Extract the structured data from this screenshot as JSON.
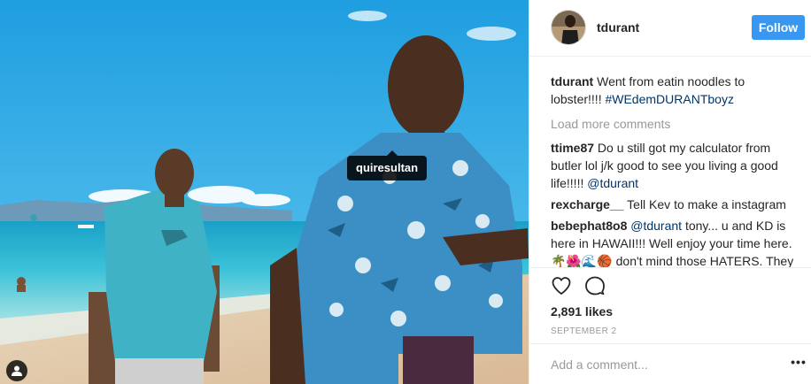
{
  "post": {
    "author": "tdurant",
    "follow_label": "Follow",
    "photo_tag": "quiresultan",
    "caption_text": "Went from eatin noodles to lobster!!!! ",
    "caption_hashtag": "#WEdemDURANTboyz",
    "load_more": "Load more comments",
    "comments": [
      {
        "user": "ttime87",
        "text": "Do u still got my calculator from butler lol j/k good to see you living a good life!!!!! ",
        "mention": "@tdurant"
      },
      {
        "user": "rexcharge__",
        "text": "Tell Kev to make a instagram"
      },
      {
        "user": "bebephat8o8",
        "mention": "@tdurant",
        "text": " tony... u and KD is here in HAWAII!!! Well enjoy your time here. 🌴🌺🌊🏀 don't mind those HATERS. They don't deserve your time. STUPID people."
      }
    ],
    "likes": "2,891 likes",
    "date": "SEPTEMBER 2",
    "add_comment_placeholder": "Add a comment...",
    "more_label": "•••"
  },
  "icons": {
    "like": "heart-outline-icon",
    "comment": "speech-bubble-icon",
    "tags": "person-tag-icon"
  },
  "colors": {
    "accent": "#3897f0",
    "link": "#003569",
    "muted": "#999999",
    "border": "#efefef"
  }
}
